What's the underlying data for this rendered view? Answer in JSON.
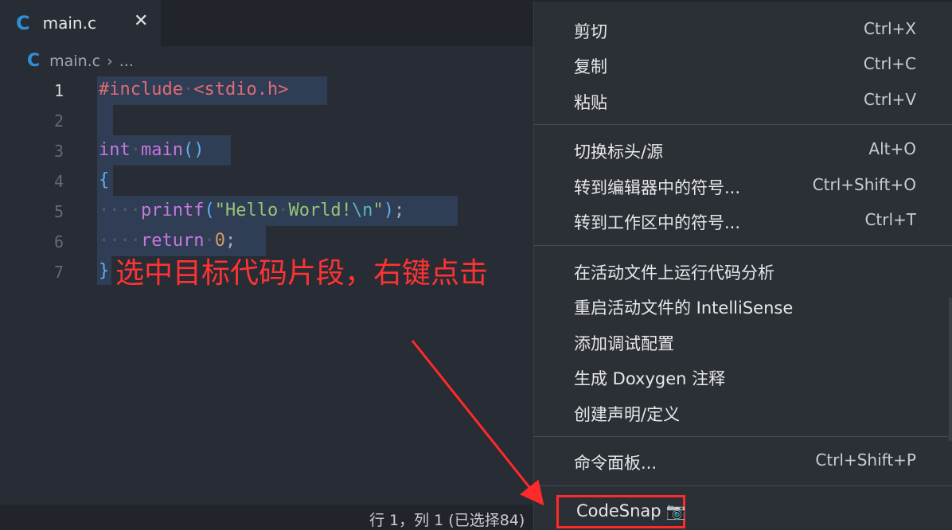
{
  "tab": {
    "icon": "C",
    "title": "main.c",
    "close": "✕"
  },
  "breadcrumb": {
    "icon": "C",
    "file": "main.c",
    "sep": "›",
    "rest": "..."
  },
  "editor": {
    "line_numbers": [
      "1",
      "2",
      "3",
      "4",
      "5",
      "6",
      "7"
    ],
    "lines": [
      "#include <stdio.h>",
      "",
      "int main()",
      "{",
      "    printf(\"Hello World!\\n\");",
      "    return 0;",
      "}"
    ]
  },
  "annotation": "选中目标代码片段，右键点击",
  "status": {
    "position": "行 1，列 1 (已选择84)"
  },
  "menu": {
    "items": [
      {
        "label": "剪切",
        "shortcut": "Ctrl+X"
      },
      {
        "label": "复制",
        "shortcut": "Ctrl+C"
      },
      {
        "label": "粘贴",
        "shortcut": "Ctrl+V"
      },
      {
        "label": "切换标头/源",
        "shortcut": "Alt+O"
      },
      {
        "label": "转到编辑器中的符号...",
        "shortcut": "Ctrl+Shift+O"
      },
      {
        "label": "转到工作区中的符号...",
        "shortcut": "Ctrl+T"
      },
      {
        "label": "在活动文件上运行代码分析",
        "shortcut": ""
      },
      {
        "label": "重启活动文件的 IntelliSense",
        "shortcut": ""
      },
      {
        "label": "添加调试配置",
        "shortcut": ""
      },
      {
        "label": "生成 Doxygen 注释",
        "shortcut": ""
      },
      {
        "label": "创建声明/定义",
        "shortcut": ""
      },
      {
        "label": "命令面板...",
        "shortcut": "Ctrl+Shift+P"
      }
    ],
    "codesnap": {
      "label": "CodeSnap",
      "icon": "📷"
    }
  },
  "colors": {
    "annotation": "#ff3333",
    "highlight_box": "#ff2a2a",
    "selection": "#2f3d55"
  }
}
